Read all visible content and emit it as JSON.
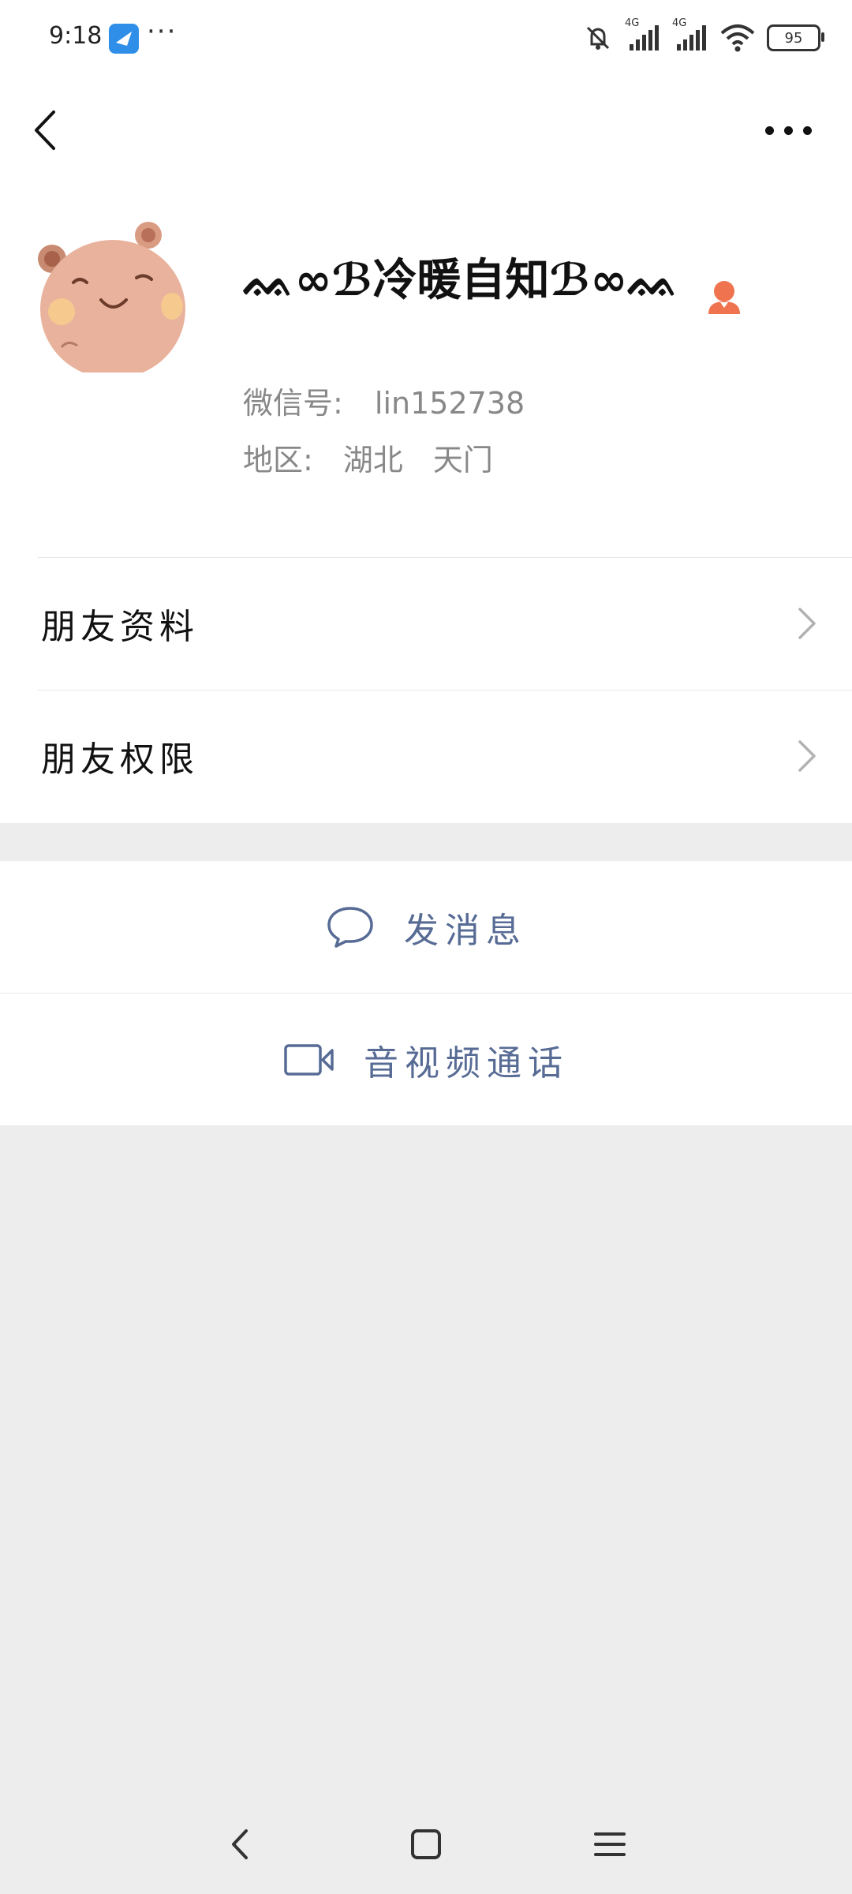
{
  "status_bar": {
    "time": "9:18",
    "more": "···",
    "battery": "95",
    "network_1": "4G",
    "network_2": "4G"
  },
  "profile": {
    "nickname": "ᨐ∞ℬ冷暖自知ℬ∞ᨐ",
    "wechat_id_label": "微信号:",
    "wechat_id": "lin152738",
    "region_label": "地区:",
    "region": "湖北　天门"
  },
  "menu": {
    "friend_info": "朋友资料",
    "friend_permissions": "朋友权限"
  },
  "actions": {
    "send_message": "发消息",
    "video_call": "音视频通话"
  },
  "colors": {
    "link_blue": "#576b95",
    "user_icon": "#f0734f",
    "background": "#ededed"
  },
  "icons": {
    "back": "back-icon",
    "more": "more-icon",
    "chat": "chat-bubble-icon",
    "video": "video-camera-icon"
  }
}
